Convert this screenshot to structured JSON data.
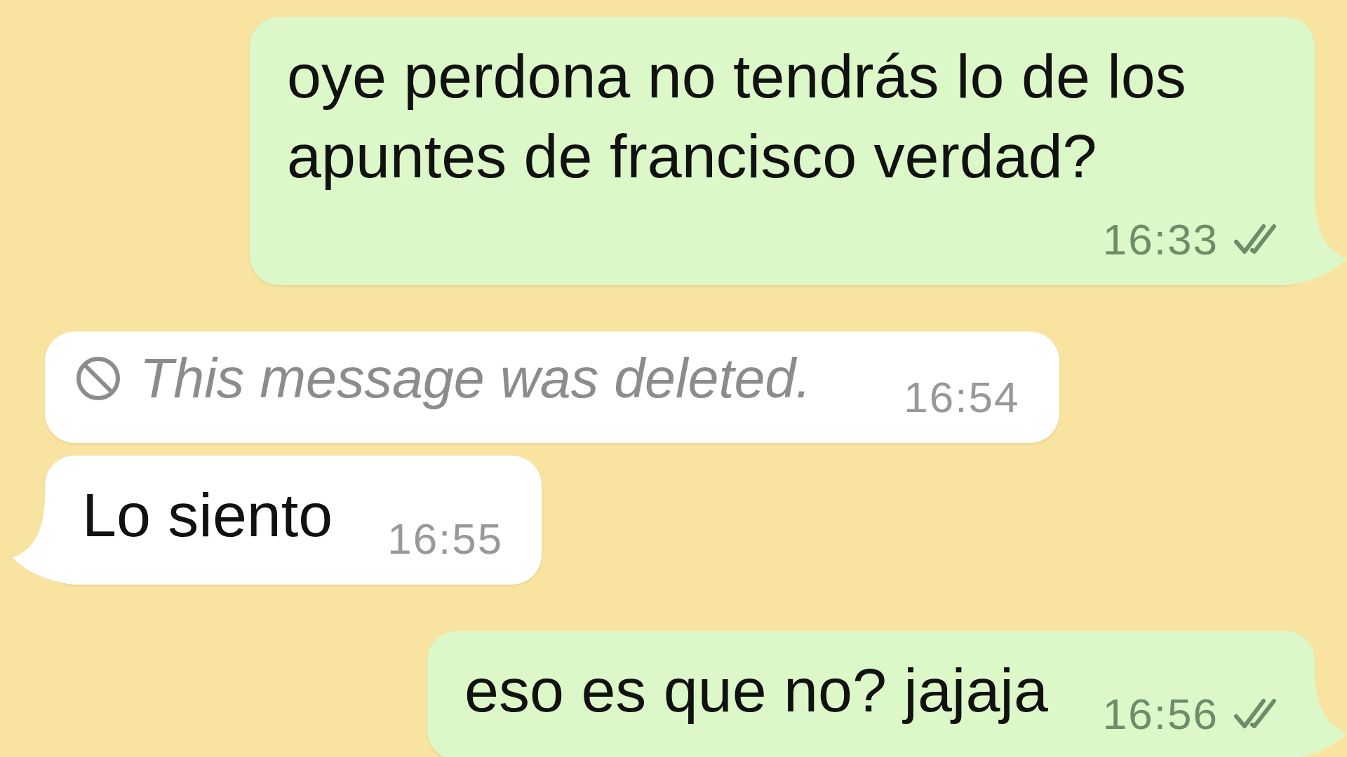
{
  "messages": [
    {
      "kind": "sent",
      "text": "oye perdona no tendrás lo de los apuntes de francisco verdad?",
      "time": "16:33",
      "delivered": true,
      "read": false,
      "tail": true
    },
    {
      "kind": "deleted",
      "text": "This message was deleted.",
      "time": "16:54",
      "tail": false
    },
    {
      "kind": "received",
      "text": "Lo siento",
      "time": "16:55",
      "tail": true
    },
    {
      "kind": "sent",
      "text": "eso es que no? jajaja",
      "time": "16:56",
      "delivered": true,
      "read": false,
      "tail": true
    }
  ]
}
